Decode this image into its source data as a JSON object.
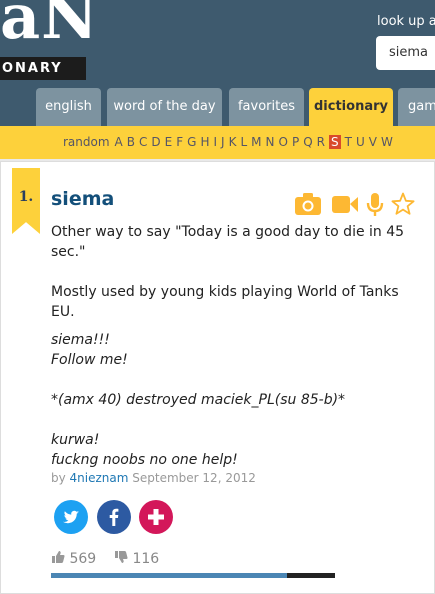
{
  "header": {
    "logo_big": "aN",
    "logo_sub": "ONARY",
    "lookup_label": "look up a",
    "search_value": "siema"
  },
  "tabs": [
    {
      "label": "english",
      "active": false
    },
    {
      "label": "word of the day",
      "active": false
    },
    {
      "label": "favorites",
      "active": false
    },
    {
      "label": "dictionary",
      "active": true
    },
    {
      "label": "gam",
      "active": false
    }
  ],
  "alphabet": {
    "random": "random",
    "letters": [
      "A",
      "B",
      "C",
      "D",
      "E",
      "F",
      "G",
      "H",
      "I",
      "J",
      "K",
      "L",
      "M",
      "N",
      "O",
      "P",
      "Q",
      "R",
      "S",
      "T",
      "U",
      "V",
      "W"
    ],
    "selected": "S"
  },
  "entry": {
    "rank": "1.",
    "word": "siema",
    "meaning": [
      "Other way to say \"Today is a good day to die in 45 sec.\"",
      "Mostly used by young kids playing World of Tanks EU."
    ],
    "example": [
      "siema!!!",
      "Follow me!",
      "",
      "*(amx 40) destroyed maciek_PL(su 85-b)*",
      "",
      "kurwa!",
      "fuckng noobs no one help!"
    ],
    "by_prefix": "by",
    "author": "4nieznam",
    "date": "September 12, 2012",
    "upvotes": "569",
    "downvotes": "116",
    "up_fraction": 0.83
  },
  "colors": {
    "header_bg": "#3e5a6e",
    "accent_yellow": "#fdd13b",
    "word_blue": "#134f7a",
    "selected_letter_bg": "#d94b2b",
    "twitter": "#1da1f2",
    "facebook": "#2d5aa2",
    "plus": "#d3175a"
  },
  "icons": [
    "camera-icon",
    "video-icon",
    "microphone-icon",
    "star-icon",
    "twitter-icon",
    "facebook-icon",
    "plus-icon",
    "thumbs-up-icon",
    "thumbs-down-icon"
  ]
}
